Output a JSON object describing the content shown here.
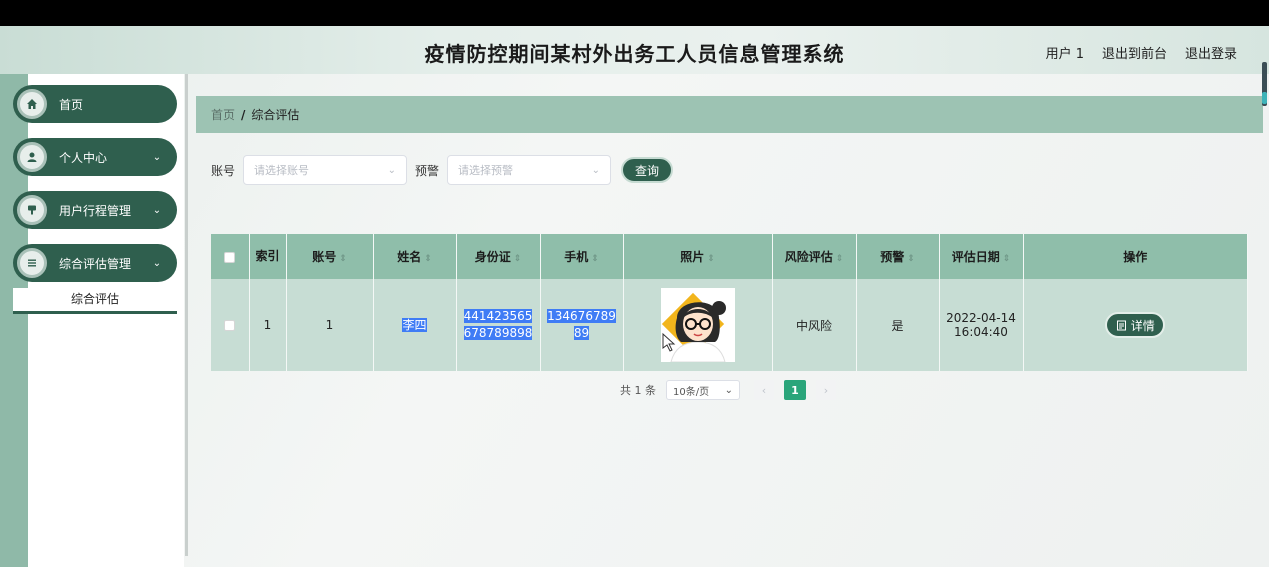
{
  "header": {
    "app_title": "疫情防控期间某村外出务工人员信息管理系统",
    "user_label": "用户 1",
    "front_link": "退出到前台",
    "logout_link": "退出登录"
  },
  "sidebar": {
    "items": [
      {
        "label": "首页",
        "icon": "home-icon"
      },
      {
        "label": "个人中心",
        "icon": "user-icon"
      },
      {
        "label": "用户行程管理",
        "icon": "itinerary-icon"
      },
      {
        "label": "综合评估管理",
        "icon": "list-icon"
      }
    ],
    "submenu": {
      "label": "综合评估"
    }
  },
  "breadcrumb": {
    "home": "首页",
    "separator": "/",
    "current": "综合评估"
  },
  "search": {
    "account_label": "账号",
    "account_placeholder": "请选择账号",
    "warning_label": "预警",
    "warning_placeholder": "请选择预警",
    "query_button": "查询"
  },
  "table": {
    "headers": [
      "索引",
      "账号",
      "姓名",
      "身份证",
      "手机",
      "照片",
      "风险评估",
      "预警",
      "评估日期",
      "操作"
    ],
    "rows": [
      {
        "index": "1",
        "account": "1",
        "name": "李四",
        "id_card_line1": "441423565",
        "id_card_line2": "678789898",
        "phone_line1": "134676789",
        "phone_line2": "89",
        "photo_icon": "avatar-cartoon-glasses",
        "risk": "中风险",
        "warning": "是",
        "date_line1": "2022-04-14",
        "date_line2": "16:04:40",
        "action_label": "详情",
        "action_icon": "document-icon"
      }
    ]
  },
  "pagination": {
    "total": "共 1 条",
    "page_size": "10条/页",
    "current_page": "1"
  },
  "colors": {
    "primary": "#2f5f4e",
    "header_row": "#8fbeaa",
    "body_row": "#c7ddd4",
    "breadcrumb": "#9dc3b3",
    "active_page": "#2aa57a"
  }
}
